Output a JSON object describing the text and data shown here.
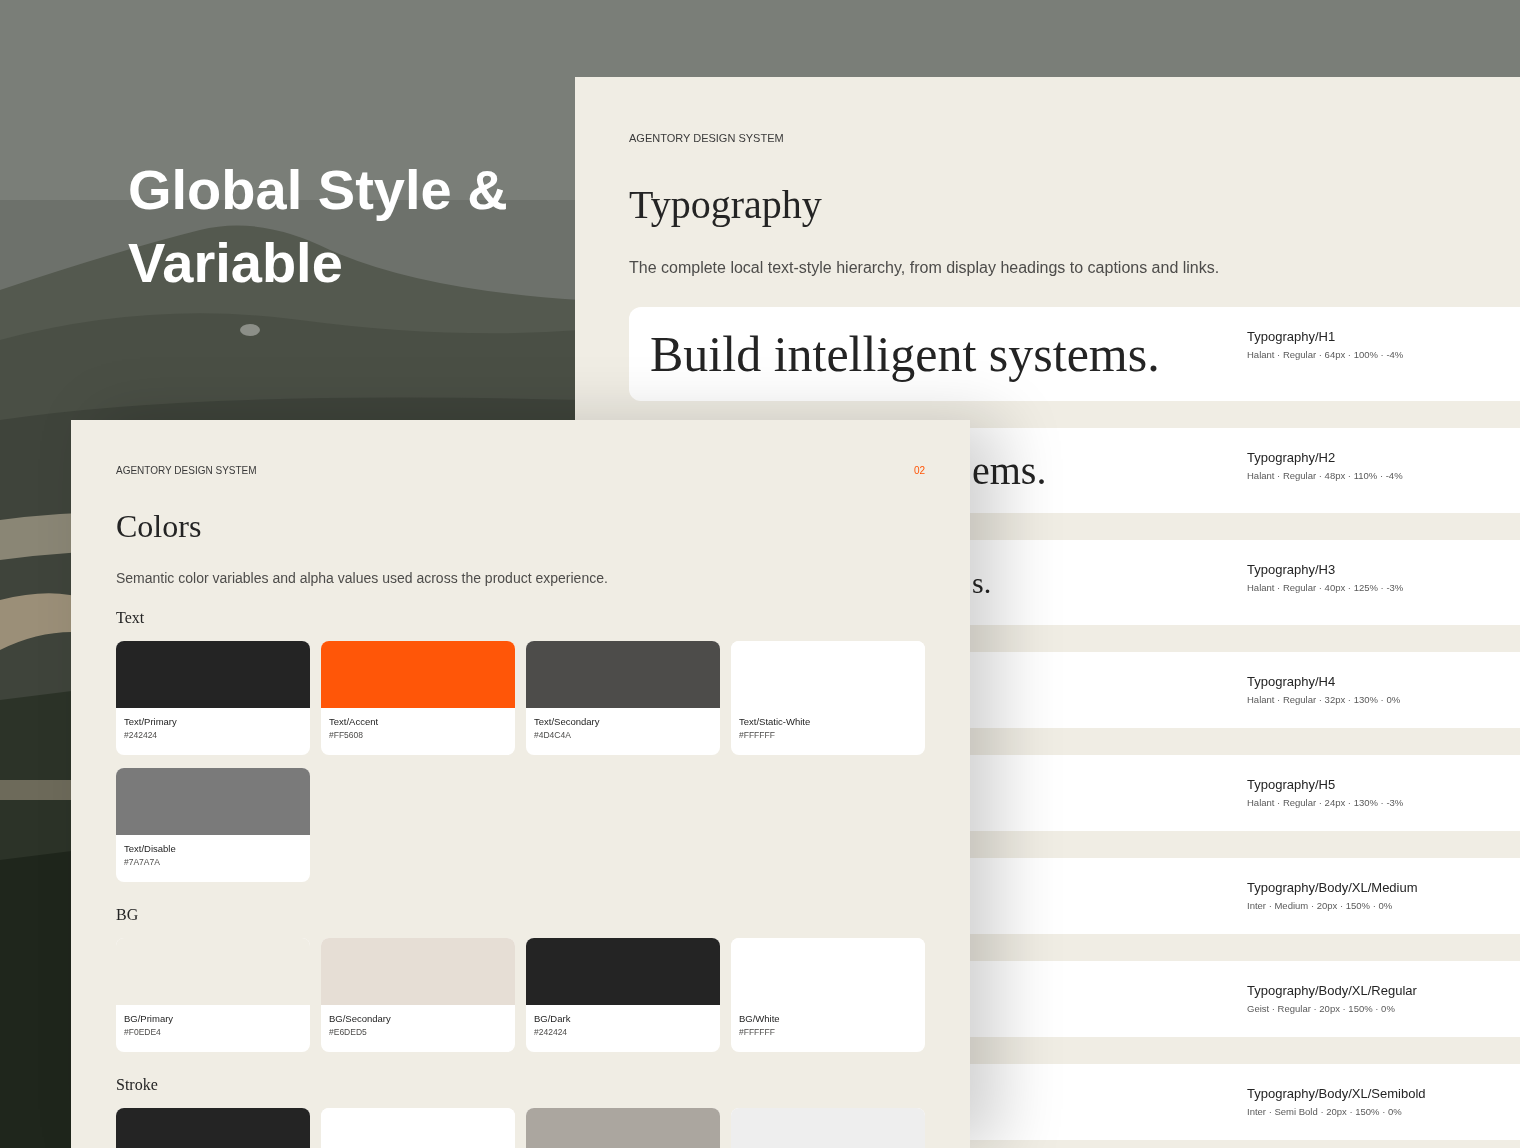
{
  "headline": "Global Style & Variable",
  "typography_page": {
    "eyebrow": "AGENTORY DESIGN SYSTEM",
    "title": "Typography",
    "description": "The complete local text-style hierarchy, from display headings to captions and links.",
    "styles": [
      {
        "kind": "full",
        "sample": "Build intelligent systems.",
        "name": "Typography/H1",
        "spec": "Halant · Regular · 64px · 100% · -4%"
      },
      {
        "kind": "partial",
        "sample": "ems.",
        "name": "Typography/H2",
        "spec": "Halant · Regular · 48px · 110% · -4%"
      },
      {
        "kind": "partial",
        "sample": "s.",
        "name": "Typography/H3",
        "spec": "Halant · Regular · 40px · 125% · -3%"
      },
      {
        "kind": "hidden",
        "name": "Typography/H4",
        "spec": "Halant · Regular · 32px · 130% · 0%"
      },
      {
        "kind": "hidden",
        "name": "Typography/H5",
        "spec": "Halant · Regular · 24px · 130% · -3%"
      },
      {
        "kind": "hidden",
        "name": "Typography/Body/XL/Medium",
        "spec": "Inter · Medium · 20px · 150% · 0%"
      },
      {
        "kind": "hidden",
        "name": "Typography/Body/XL/Regular",
        "spec": "Geist · Regular · 20px · 150% · 0%"
      },
      {
        "kind": "hidden",
        "name": "Typography/Body/XL/Semibold",
        "spec": "Inter · Semi Bold · 20px · 150% · 0%"
      }
    ]
  },
  "colors_page": {
    "eyebrow": "AGENTORY DESIGN SYSTEM",
    "page_number": "02",
    "title": "Colors",
    "description": "Semantic color variables and alpha values used across the product experience.",
    "sections": [
      {
        "title": "Text",
        "swatches": [
          {
            "name": "Text/Primary",
            "hex": "#242424",
            "color": "#242424"
          },
          {
            "name": "Text/Accent",
            "hex": "#FF5608",
            "color": "#ff5608"
          },
          {
            "name": "Text/Secondary",
            "hex": "#4D4C4A",
            "color": "#4d4c4a"
          },
          {
            "name": "Text/Static-White",
            "hex": "#FFFFFF",
            "color": "#ffffff"
          },
          {
            "name": "Text/Disable",
            "hex": "#7A7A7A",
            "color": "#7a7a7a"
          }
        ]
      },
      {
        "title": "BG",
        "swatches": [
          {
            "name": "BG/Primary",
            "hex": "#F0EDE4",
            "color": "#f0ede4"
          },
          {
            "name": "BG/Secondary",
            "hex": "#E6DED5",
            "color": "#e6ded5"
          },
          {
            "name": "BG/Dark",
            "hex": "#242424",
            "color": "#242424"
          },
          {
            "name": "BG/White",
            "hex": "#FFFFFF",
            "color": "#ffffff"
          }
        ]
      },
      {
        "title": "Stroke",
        "swatches": [
          {
            "color": "#242424"
          },
          {
            "color": "#ffffff"
          },
          {
            "color": "#aba69f"
          },
          {
            "color": "#eeeeee"
          }
        ]
      }
    ]
  }
}
